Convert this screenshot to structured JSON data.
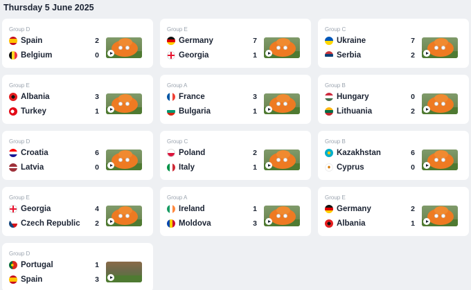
{
  "date_heading": "Thursday 5 June 2025",
  "matches": [
    {
      "group": "Group D",
      "home": {
        "name": "Spain",
        "score": "2",
        "flag": "spain-flag-icon"
      },
      "away": {
        "name": "Belgium",
        "score": "0",
        "flag": "belgium-flag-icon"
      }
    },
    {
      "group": "Group E",
      "home": {
        "name": "Germany",
        "score": "7",
        "flag": "germany-flag-icon"
      },
      "away": {
        "name": "Georgia",
        "score": "1",
        "flag": "georgia-flag-icon"
      }
    },
    {
      "group": "Group C",
      "home": {
        "name": "Ukraine",
        "score": "7",
        "flag": "ukraine-flag-icon"
      },
      "away": {
        "name": "Serbia",
        "score": "2",
        "flag": "serbia-flag-icon"
      }
    },
    {
      "group": "Group E",
      "home": {
        "name": "Albania",
        "score": "3",
        "flag": "albania-flag-icon"
      },
      "away": {
        "name": "Turkey",
        "score": "1",
        "flag": "turkey-flag-icon"
      }
    },
    {
      "group": "Group A",
      "home": {
        "name": "France",
        "score": "3",
        "flag": "france-flag-icon"
      },
      "away": {
        "name": "Bulgaria",
        "score": "1",
        "flag": "bulgaria-flag-icon"
      }
    },
    {
      "group": "Group B",
      "home": {
        "name": "Hungary",
        "score": "0",
        "flag": "hungary-flag-icon"
      },
      "away": {
        "name": "Lithuania",
        "score": "2",
        "flag": "lithuania-flag-icon"
      }
    },
    {
      "group": "Group D",
      "home": {
        "name": "Croatia",
        "score": "6",
        "flag": "croatia-flag-icon"
      },
      "away": {
        "name": "Latvia",
        "score": "0",
        "flag": "latvia-flag-icon"
      }
    },
    {
      "group": "Group C",
      "home": {
        "name": "Poland",
        "score": "2",
        "flag": "poland-flag-icon"
      },
      "away": {
        "name": "Italy",
        "score": "1",
        "flag": "italy-flag-icon"
      }
    },
    {
      "group": "Group B",
      "home": {
        "name": "Kazakhstan",
        "score": "6",
        "flag": "kazakhstan-flag-icon"
      },
      "away": {
        "name": "Cyprus",
        "score": "0",
        "flag": "cyprus-flag-icon"
      }
    },
    {
      "group": "Group E",
      "home": {
        "name": "Georgia",
        "score": "4",
        "flag": "georgia-flag-icon"
      },
      "away": {
        "name": "Czech Republic",
        "score": "2",
        "flag": "czech-flag-icon"
      }
    },
    {
      "group": "Group A",
      "home": {
        "name": "Ireland",
        "score": "1",
        "flag": "ireland-flag-icon"
      },
      "away": {
        "name": "Moldova",
        "score": "3",
        "flag": "moldova-flag-icon"
      }
    },
    {
      "group": "Group E",
      "home": {
        "name": "Germany",
        "score": "2",
        "flag": "germany-flag-icon"
      },
      "away": {
        "name": "Albania",
        "score": "1",
        "flag": "albania-flag-icon"
      }
    },
    {
      "group": "Group D",
      "home": {
        "name": "Portugal",
        "score": "1",
        "flag": "portugal-flag-icon"
      },
      "away": {
        "name": "Spain",
        "score": "3",
        "flag": "spain-flag-icon"
      }
    }
  ]
}
